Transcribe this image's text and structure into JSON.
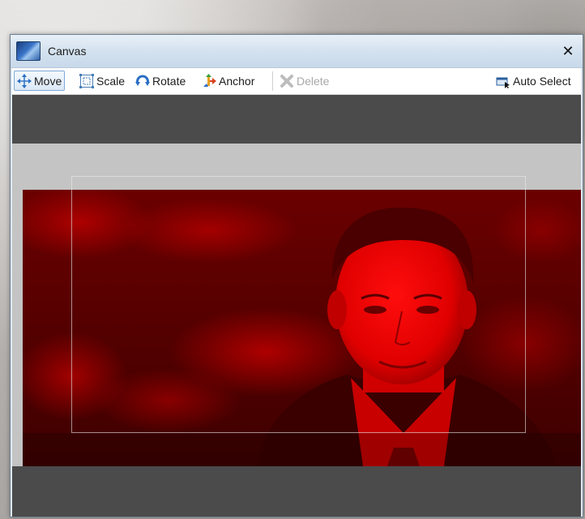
{
  "window": {
    "title": "Canvas",
    "close_glyph": "✕"
  },
  "toolbar": {
    "move_label": "Move",
    "scale_label": "Scale",
    "rotate_label": "Rotate",
    "anchor_label": "Anchor",
    "delete_label": "Delete",
    "auto_select_label": "Auto Select"
  },
  "icons": {
    "app": "canvas-app-icon",
    "move": "move-arrows-icon",
    "scale": "scale-box-icon",
    "rotate": "rotate-icon",
    "anchor": "anchor-icon",
    "delete": "delete-x-icon",
    "auto_select": "auto-select-icon"
  },
  "colors": {
    "photo_tint": "#c40000",
    "canvas_bg": "#4b4b4b",
    "stage_band": "#c4c4c4",
    "titlebar": "#d4e2ef"
  }
}
